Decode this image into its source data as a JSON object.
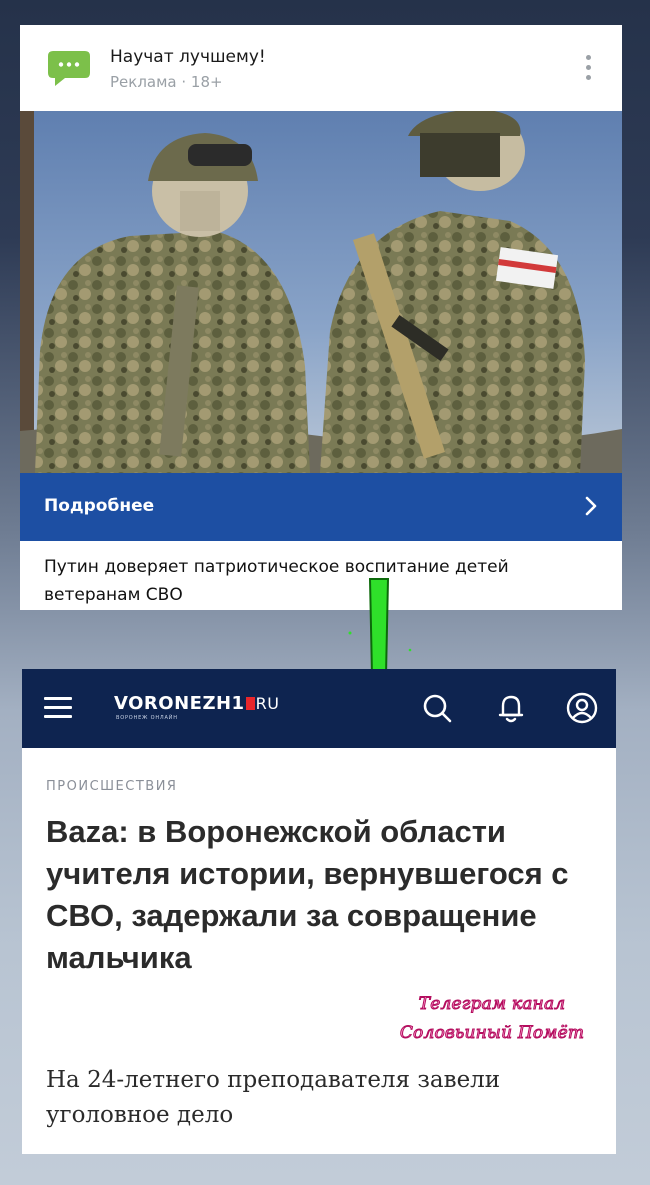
{
  "ad": {
    "title": "Научат лучшему!",
    "subtitle": "Реклама · 18+",
    "icon": "chat-bubble-icon",
    "cta_label": "Подробнее",
    "caption": "Путин доверяет патриотическое воспитание детей ветеранам СВО",
    "cta_color": "#1d4fa3"
  },
  "news": {
    "header_color": "#0e2450",
    "logo": {
      "name": "VORONEZH1",
      "domain": "RU",
      "tagline": "ВОРОНЕЖ ОНЛАЙН"
    },
    "icons": [
      "menu-icon",
      "search-icon",
      "bell-icon",
      "user-icon"
    ],
    "category": "ПРОИСШЕСТВИЯ",
    "title": "Baza: в Воронежской области учителя истории, вернувшегося с СВО, задержали за совращение мальчика",
    "lead": "На 24-летнего преподавателя завели уголовное дело"
  },
  "watermark": {
    "line1": "Телеграм канал",
    "line2": "Соловьиный Помёт"
  },
  "overlay": {
    "arrow_color": "#2fe02a"
  }
}
